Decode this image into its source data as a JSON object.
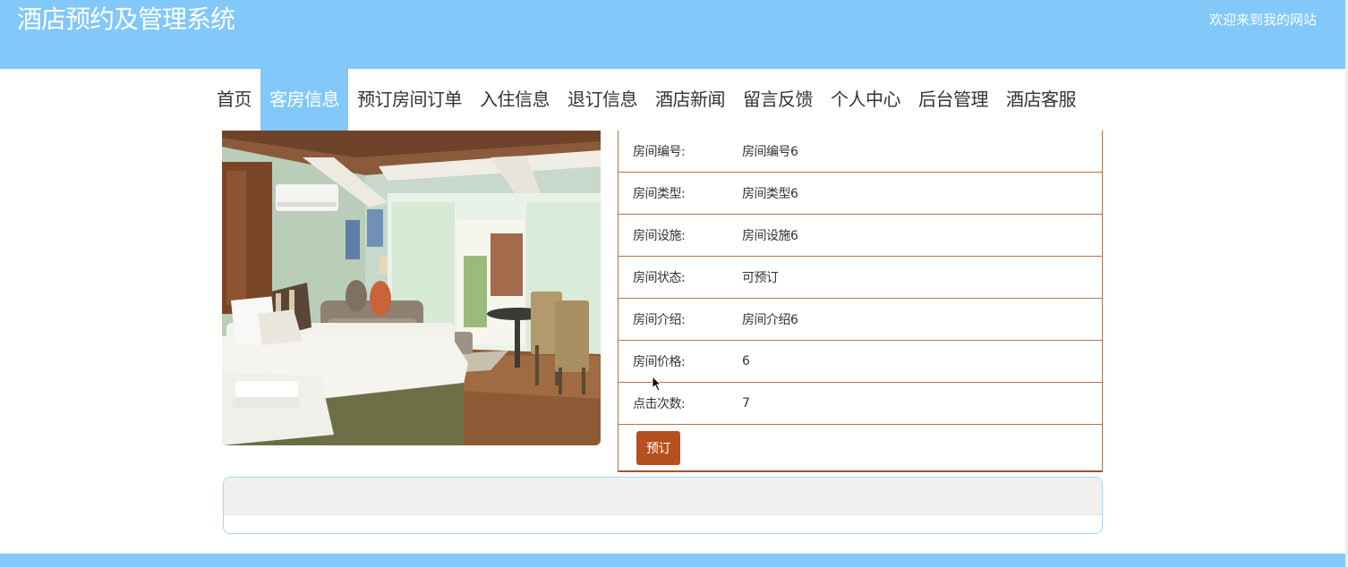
{
  "header": {
    "title": "酒店预约及管理系统",
    "welcome": "欢迎来到我的网站"
  },
  "nav": {
    "items": [
      "首页",
      "客房信息",
      "预订房间订单",
      "入住信息",
      "退订信息",
      "酒店新闻",
      "留言反馈",
      "个人中心",
      "后台管理",
      "酒店客服"
    ],
    "active": "客房信息"
  },
  "room": {
    "photo": "hotel-room-photo",
    "details": [
      {
        "label": "房间编号:",
        "value": "房间编号6"
      },
      {
        "label": "房间类型:",
        "value": "房间类型6"
      },
      {
        "label": "房间设施:",
        "value": "房间设施6"
      },
      {
        "label": "房间状态:",
        "value": "可预订"
      },
      {
        "label": "房间介绍:",
        "value": "房间介绍6"
      },
      {
        "label": "房间价格:",
        "value": "6"
      },
      {
        "label": "点击次数:",
        "value": "7"
      }
    ],
    "book_label": "预订"
  },
  "colors": {
    "brand": "#82c8f9",
    "button": "#b4511f",
    "table_border": "#b07550"
  }
}
